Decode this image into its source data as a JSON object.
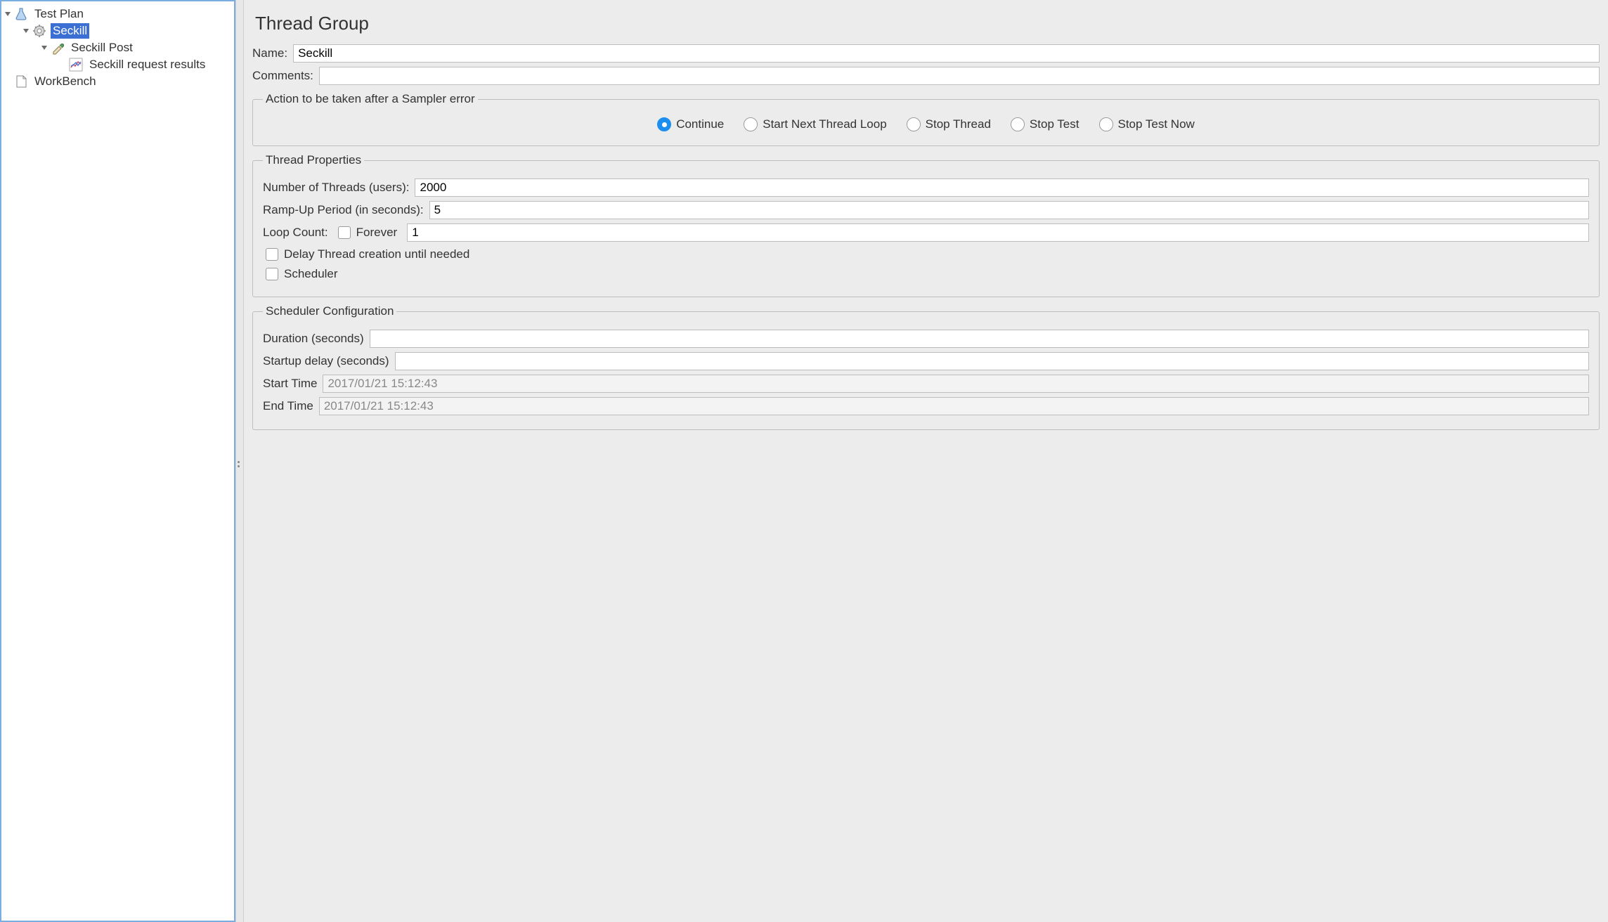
{
  "tree": {
    "testPlan": "Test Plan",
    "seckill": "Seckill",
    "seckillPost": "Seckill Post",
    "seckillResults": "Seckill request results",
    "workBench": "WorkBench"
  },
  "main": {
    "title": "Thread Group",
    "nameLabel": "Name:",
    "nameValue": "Seckill",
    "commentsLabel": "Comments:",
    "commentsValue": ""
  },
  "samplerError": {
    "legend": "Action to be taken after a Sampler error",
    "options": {
      "continue": "Continue",
      "startNext": "Start Next Thread Loop",
      "stopThread": "Stop Thread",
      "stopTest": "Stop Test",
      "stopTestNow": "Stop Test Now"
    }
  },
  "threadProps": {
    "legend": "Thread Properties",
    "numThreadsLabel": "Number of Threads (users):",
    "numThreadsValue": "2000",
    "rampUpLabel": "Ramp-Up Period (in seconds):",
    "rampUpValue": "5",
    "loopCountLabel": "Loop Count:",
    "foreverLabel": "Forever",
    "loopCountValue": "1",
    "delayLabel": "Delay Thread creation until needed",
    "schedulerLabel": "Scheduler"
  },
  "scheduler": {
    "legend": "Scheduler Configuration",
    "durationLabel": "Duration (seconds)",
    "durationValue": "",
    "startupDelayLabel": "Startup delay (seconds)",
    "startupDelayValue": "",
    "startTimeLabel": "Start Time",
    "startTimeValue": "2017/01/21 15:12:43",
    "endTimeLabel": "End Time",
    "endTimeValue": "2017/01/21 15:12:43"
  }
}
